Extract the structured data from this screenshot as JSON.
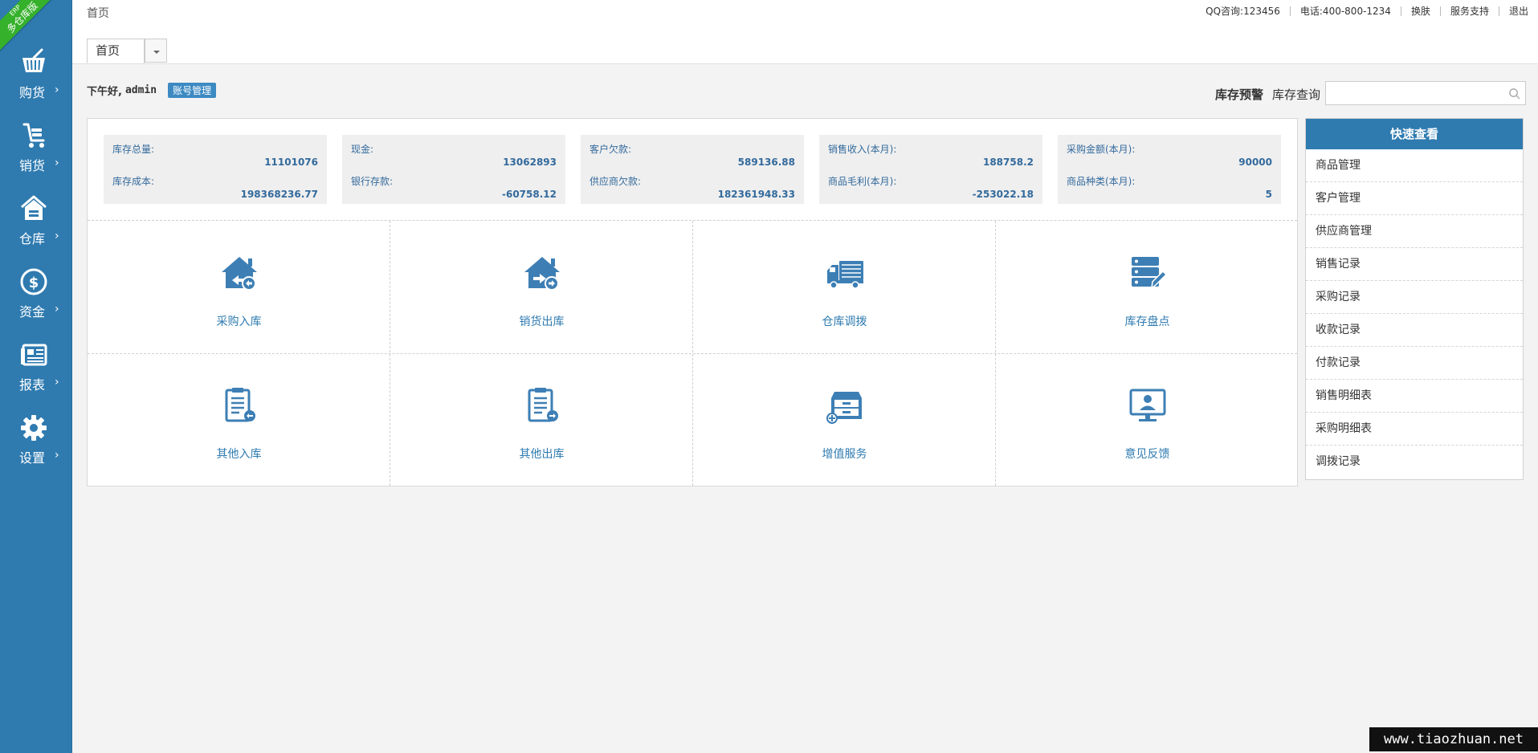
{
  "app": {
    "tab_title": "首页",
    "greeting": "下午好,",
    "username": "admin",
    "account_button": "账号管理"
  },
  "header": {
    "faded_title": "首页",
    "links": [
      {
        "label": "QQ咨询:123456"
      },
      {
        "label": "电话:400-800-1234"
      },
      {
        "label": "换肤"
      },
      {
        "label": "服务支持"
      },
      {
        "label": "退出"
      }
    ]
  },
  "ribbon": {
    "line1": "ERP",
    "line2": "多仓库版"
  },
  "sidebar": {
    "items": [
      {
        "label": "购货",
        "icon": "basket-icon"
      },
      {
        "label": "销货",
        "icon": "cart-icon"
      },
      {
        "label": "仓库",
        "icon": "warehouse-icon"
      },
      {
        "label": "资金",
        "icon": "dollar-icon"
      },
      {
        "label": "报表",
        "icon": "report-icon"
      },
      {
        "label": "设置",
        "icon": "gear-icon"
      }
    ],
    "arrow": "›"
  },
  "inventory": {
    "warn_label": "库存预警",
    "query_label": "库存查询",
    "search_placeholder": ""
  },
  "stats": [
    {
      "label1": "库存总量:",
      "value1": "11101076",
      "label2": "库存成本:",
      "value2": "198368236.77"
    },
    {
      "label1": "现金:",
      "value1": "13062893",
      "label2": "银行存款:",
      "value2": "-60758.12"
    },
    {
      "label1": "客户欠款:",
      "value1": "589136.88",
      "label2": "供应商欠款:",
      "value2": "182361948.33"
    },
    {
      "label1": "销售收入(本月):",
      "value1": "188758.2",
      "label2": "商品毛利(本月):",
      "value2": "-253022.18"
    },
    {
      "label1": "采购金额(本月):",
      "value1": "90000",
      "label2": "商品种类(本月):",
      "value2": "5"
    }
  ],
  "shortcuts": [
    {
      "label": "采购入库",
      "icon": "house-in-icon"
    },
    {
      "label": "销货出库",
      "icon": "house-out-icon"
    },
    {
      "label": "仓库调拨",
      "icon": "truck-icon"
    },
    {
      "label": "库存盘点",
      "icon": "server-edit-icon"
    },
    {
      "label": "其他入库",
      "icon": "clipboard-in-icon"
    },
    {
      "label": "其他出库",
      "icon": "clipboard-out-icon"
    },
    {
      "label": "增值服务",
      "icon": "cabinet-plus-icon"
    },
    {
      "label": "意见反馈",
      "icon": "monitor-user-icon"
    }
  ],
  "quick_view": {
    "title": "快速查看",
    "items": [
      "商品管理",
      "客户管理",
      "供应商管理",
      "销售记录",
      "采购记录",
      "收款记录",
      "付款记录",
      "销售明细表",
      "采购明细表",
      "调拨记录"
    ]
  },
  "watermark": "www.tiaozhuan.net",
  "colors": {
    "accent": "#2f7bb0",
    "ribbon": "#35b12b",
    "page_bg": "#f3f3f3"
  }
}
